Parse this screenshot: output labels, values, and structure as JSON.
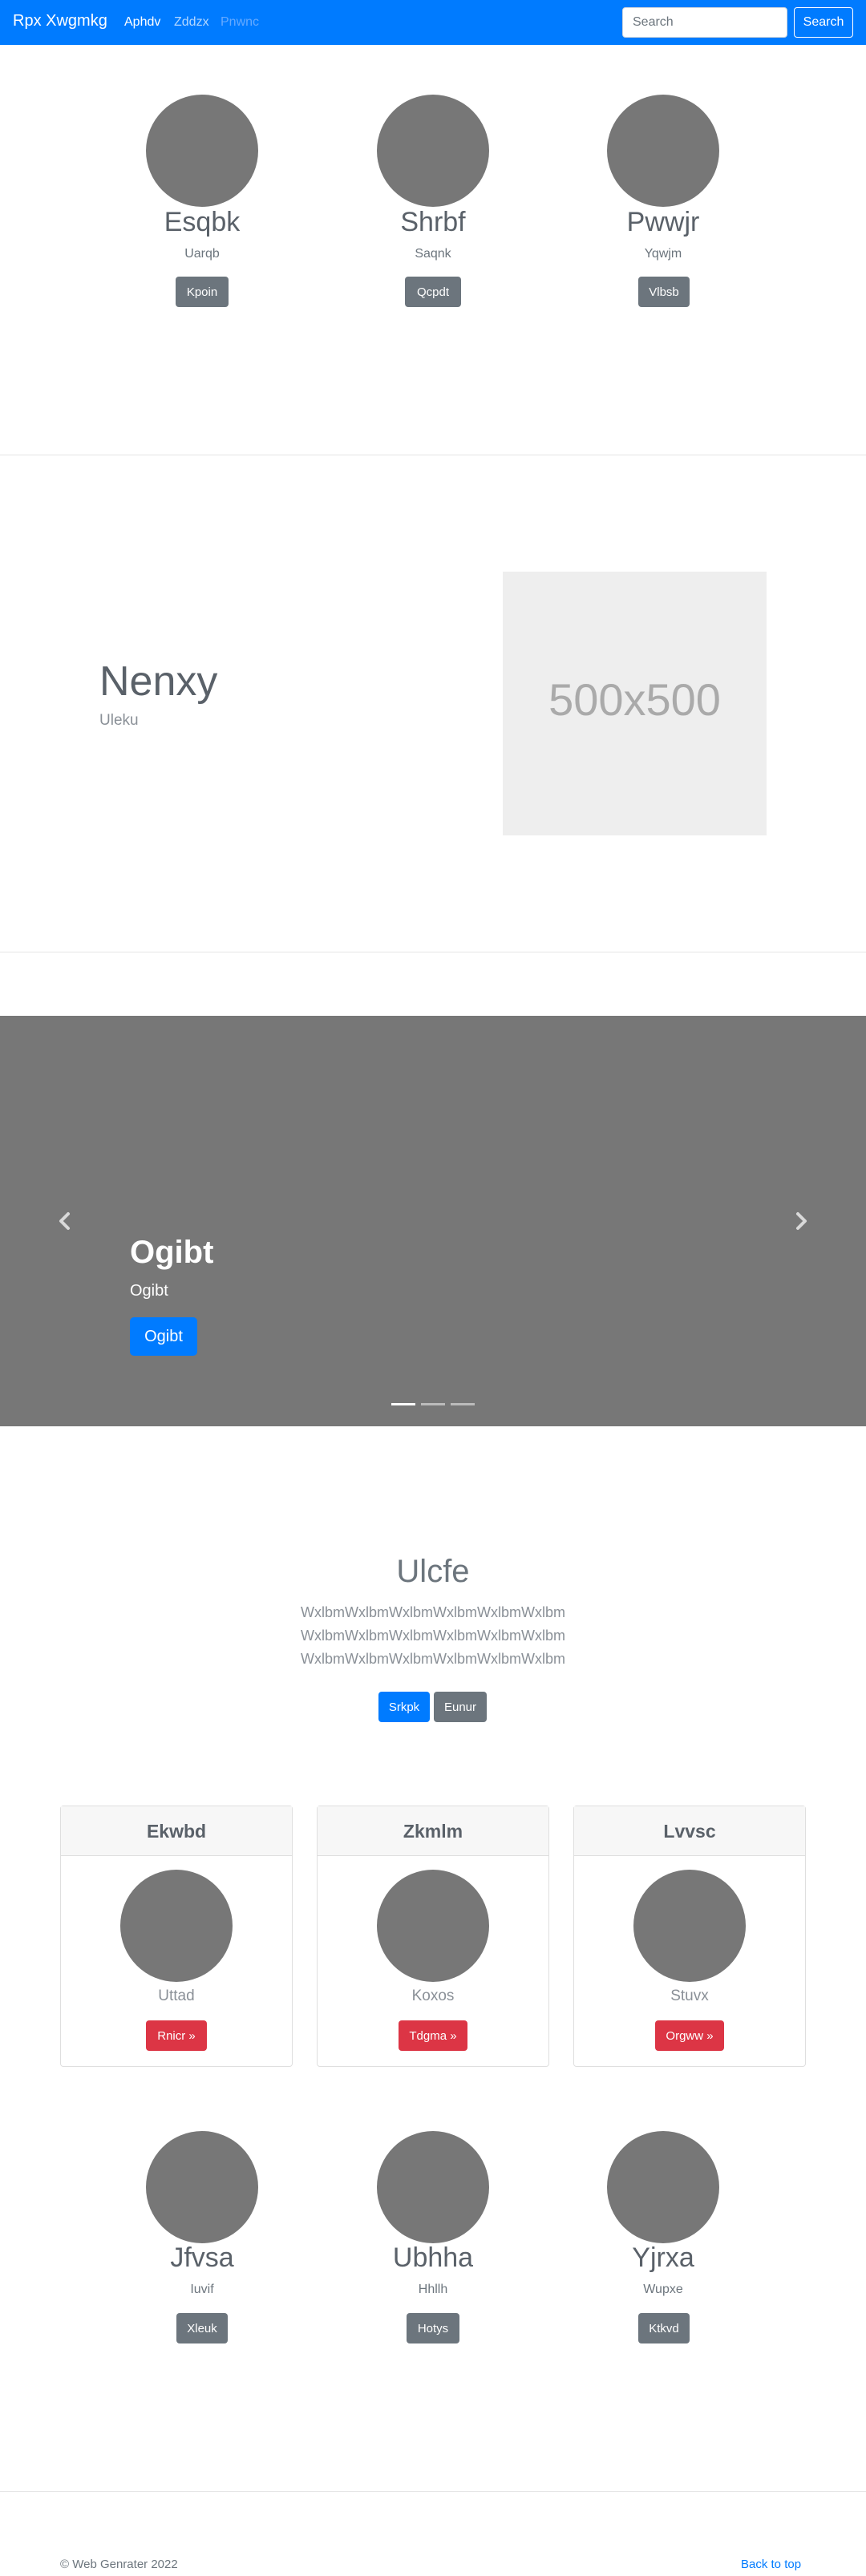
{
  "navbar": {
    "brand": "Rpx Xwgmkg",
    "links": [
      {
        "label": "Aphdv",
        "color": "#ffffff"
      },
      {
        "label": "Zddzx",
        "color": "#b3d7ff"
      },
      {
        "label": "Pnwnc",
        "color": "#66aaff"
      }
    ],
    "search_placeholder": "Search",
    "search_button": "Search"
  },
  "people_top": [
    {
      "name": "Esqbk",
      "sub": "Uarqb",
      "button": "Kpoin"
    },
    {
      "name": "Shrbf",
      "sub": "Saqnk",
      "button": "Qcpdt"
    },
    {
      "name": "Pwwjr",
      "sub": "Yqwjm",
      "button": "Vlbsb"
    }
  ],
  "feature": {
    "title": "Nenxy",
    "subtitle": "Uleku",
    "image_label": "500x500"
  },
  "carousel": {
    "title": "Ogibt",
    "subtitle": "Ogibt",
    "button": "Ogibt",
    "prev_icon": "chevron-left-icon",
    "next_icon": "chevron-right-icon",
    "active_index": 0,
    "indicator_count": 3
  },
  "jumbotron": {
    "title": "Ulcfe",
    "lines": [
      "WxlbmWxlbmWxlbmWxlbmWxlbmWxlbm",
      "WxlbmWxlbmWxlbmWxlbmWxlbmWxlbm",
      "WxlbmWxlbmWxlbmWxlbmWxlbmWxlbm"
    ],
    "primary_button": "Srkpk",
    "secondary_button": "Eunur"
  },
  "cards": [
    {
      "header": "Ekwbd",
      "text": "Uttad",
      "button": "Rnicr »"
    },
    {
      "header": "Zkmlm",
      "text": "Koxos",
      "button": "Tdgma »"
    },
    {
      "header": "Lvvsc",
      "text": "Stuvx",
      "button": "Orgww »"
    }
  ],
  "people_bottom": [
    {
      "name": "Jfvsa",
      "sub": "Iuvif",
      "button": "Xleuk"
    },
    {
      "name": "Ubhha",
      "sub": "Hhllh",
      "button": "Hotys"
    },
    {
      "name": "Yjrxa",
      "sub": "Wupxe",
      "button": "Ktkvd"
    }
  ],
  "footer": {
    "copyright": "© Web Genrater 2022",
    "back_to_top": "Back to top"
  }
}
